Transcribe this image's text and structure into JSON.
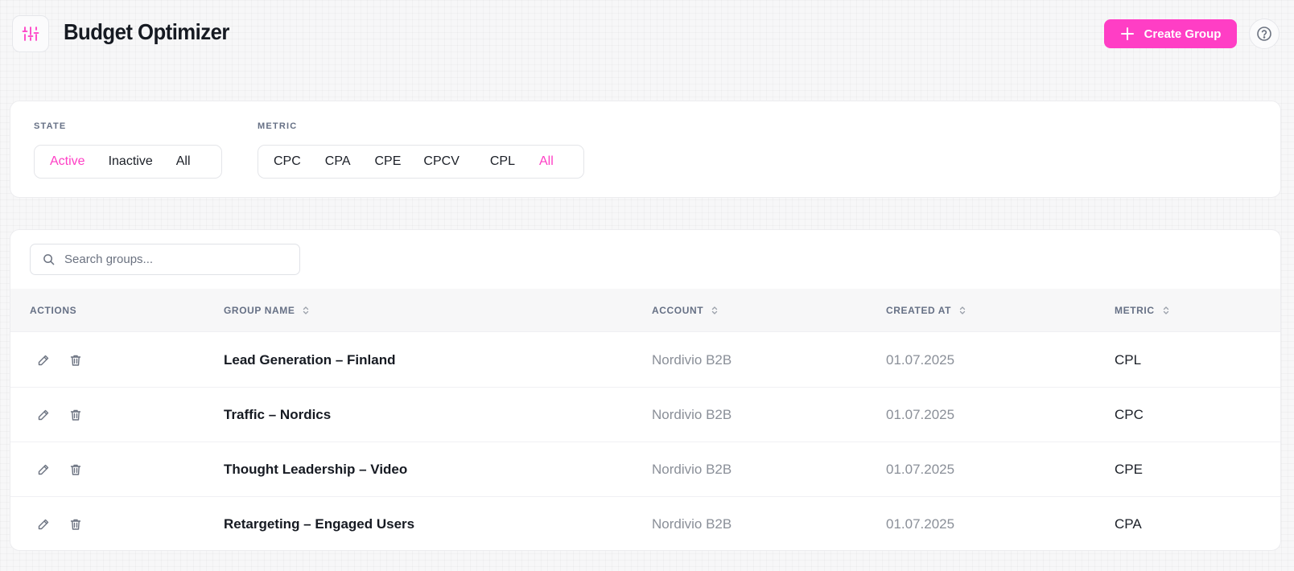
{
  "header": {
    "title": "Budget Optimizer",
    "create_label": "Create Group",
    "logo_icon": "sliders-icon",
    "help_icon": "help-circle-icon"
  },
  "colors": {
    "accent": "#ff3ec5",
    "text": "#161a22",
    "muted": "#8a8f98",
    "label": "#667085"
  },
  "filters": {
    "state": {
      "label": "STATE",
      "options": [
        "Active",
        "Inactive",
        "All"
      ],
      "selected": "Active"
    },
    "metric": {
      "label": "METRIC",
      "options": [
        "CPC",
        "CPA",
        "CPE",
        "CPCV",
        "CPL",
        "All"
      ],
      "selected": "All"
    }
  },
  "search": {
    "placeholder": "Search groups...",
    "value": ""
  },
  "table": {
    "columns": {
      "actions": "ACTIONS",
      "group_name": "GROUP NAME",
      "account": "ACCOUNT",
      "created_at": "CREATED AT",
      "metric": "METRIC"
    },
    "rows": [
      {
        "group_name": "Lead Generation – Finland",
        "account": "Nordivio B2B",
        "created_at": "01.07.2025",
        "metric": "CPL"
      },
      {
        "group_name": "Traffic – Nordics",
        "account": "Nordivio B2B",
        "created_at": "01.07.2025",
        "metric": "CPC"
      },
      {
        "group_name": "Thought Leadership – Video",
        "account": "Nordivio B2B",
        "created_at": "01.07.2025",
        "metric": "CPE"
      },
      {
        "group_name": "Retargeting – Engaged Users",
        "account": "Nordivio B2B",
        "created_at": "01.07.2025",
        "metric": "CPA"
      }
    ]
  }
}
